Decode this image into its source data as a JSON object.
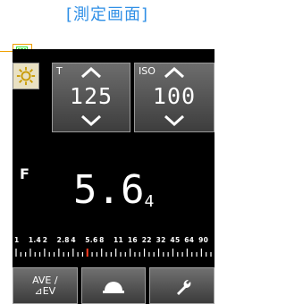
{
  "caption": "[測定画面]",
  "battery_icon": "battery-full-icon",
  "mode_icon": "sun-icon",
  "shutter": {
    "label": "T",
    "value": "125"
  },
  "iso": {
    "label": "ISO",
    "value": "100"
  },
  "aperture": {
    "label": "F",
    "value": "5.6",
    "subvalue": "4"
  },
  "scale_labels": [
    "1",
    "1.4",
    "2",
    "2.8",
    "4",
    "5.6",
    "8",
    "11",
    "16",
    "22",
    "32",
    "45",
    "64",
    "90"
  ],
  "scale_marker_value": "5.6",
  "bottom_buttons": {
    "ave_line1": "AVE /",
    "ave_line2": "⊿EV",
    "dome_icon": "dome-icon",
    "wrench_icon": "wrench-icon"
  },
  "colors": {
    "caption": "#2f8fe6",
    "battery": "#33dd33",
    "callout": "#f0a000",
    "marker": "#ff3b1f"
  }
}
